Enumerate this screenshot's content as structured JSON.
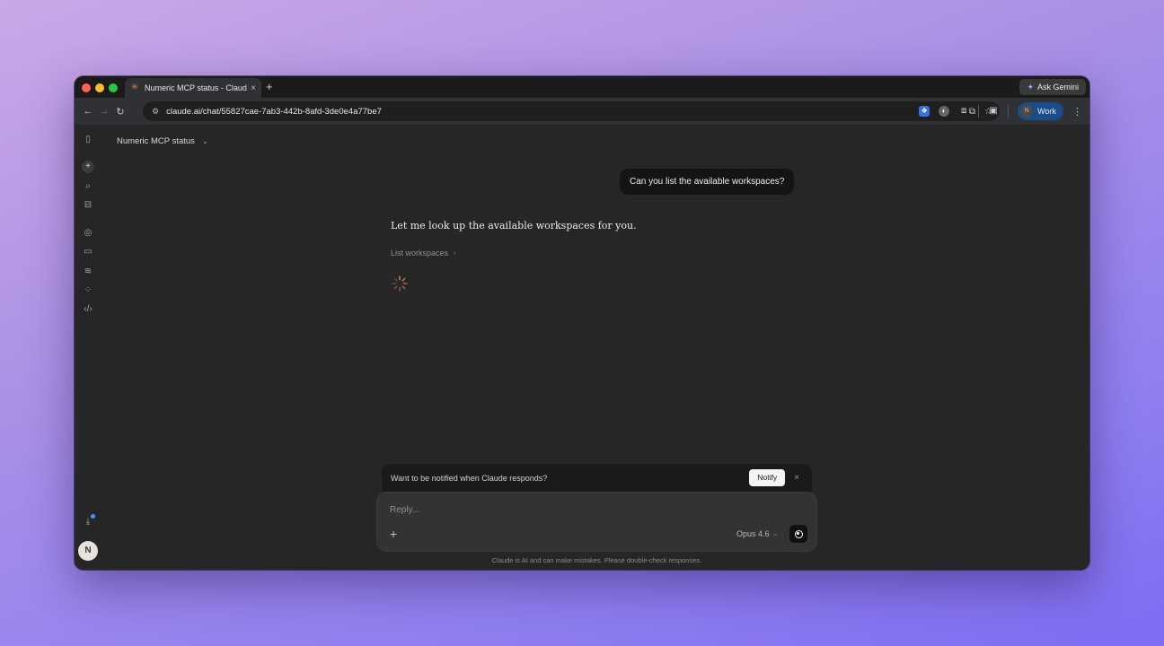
{
  "browser": {
    "tab_title": "Numeric MCP status - Claude",
    "tab_close": "×",
    "new_tab": "+",
    "ask_gemini": "Ask Gemini",
    "url": "claude.ai/chat/55827cae-7ab3-442b-8afd-3de0e4a77be7",
    "profile_initial": "N",
    "profile_label": "Work"
  },
  "conversation": {
    "title": "Numeric MCP status",
    "user_message": "Can you list the available workspaces?",
    "assistant_message": "Let me look up the available workspaces for you.",
    "tool_call": "List workspaces"
  },
  "notify": {
    "text": "Want to be notified when Claude responds?",
    "button": "Notify",
    "close": "×"
  },
  "composer": {
    "placeholder": "Reply...",
    "model": "Opus 4.6"
  },
  "disclaimer": "Claude is AI and can make mistakes. Please double-check responses.",
  "user": {
    "initial": "N"
  },
  "colors": {
    "background_gradient_start": "#c9a8e6",
    "background_gradient_end": "#7e6cf2",
    "app_bg": "#262626",
    "accent_blue": "#1a4c8a",
    "claude_orange": "#e07b53"
  }
}
